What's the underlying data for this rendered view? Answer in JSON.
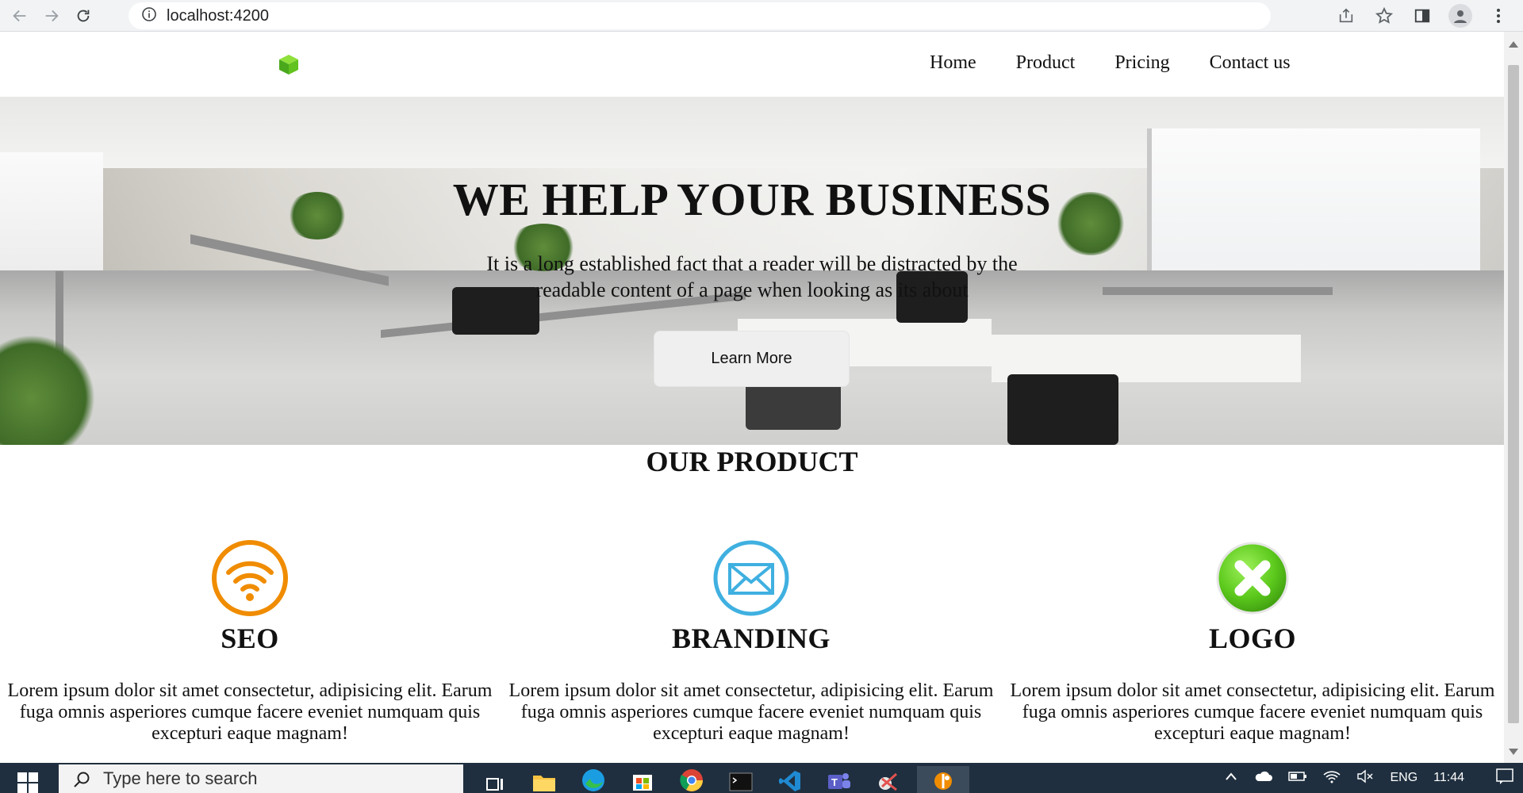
{
  "browser": {
    "url": "localhost:4200"
  },
  "site": {
    "nav": [
      "Home",
      "Product",
      "Pricing",
      "Contact us"
    ],
    "hero": {
      "title": "WE HELP YOUR BUSINESS",
      "text": "It is a long established fact that a reader will be distracted by the readable content of a page when looking as its about",
      "button": "Learn More"
    },
    "products_title": "OUR PRODUCT",
    "products": [
      {
        "name": "SEO",
        "icon": "wifi-icon",
        "text": "Lorem ipsum dolor sit amet consectetur, adipisicing elit. Earum fuga omnis asperiores cumque facere eveniet numquam quis excepturi eaque magnam!"
      },
      {
        "name": "BRANDING",
        "icon": "envelope-icon",
        "text": "Lorem ipsum dolor sit amet consectetur, adipisicing elit. Earum fuga omnis asperiores cumque facere eveniet numquam quis excepturi eaque magnam!"
      },
      {
        "name": "LOGO",
        "icon": "close-circle-icon",
        "text": "Lorem ipsum dolor sit amet consectetur, adipisicing elit. Earum fuga omnis asperiores cumque facere eveniet numquam quis excepturi eaque magnam!"
      }
    ]
  },
  "taskbar": {
    "search_placeholder": "Type here to search",
    "language": "ENG",
    "time": "11:44"
  },
  "colors": {
    "seo_orange": "#f08c00",
    "branding_blue": "#3fb0e0",
    "logo_green": "#5cc91c",
    "taskbar": "#1f2f3f"
  }
}
